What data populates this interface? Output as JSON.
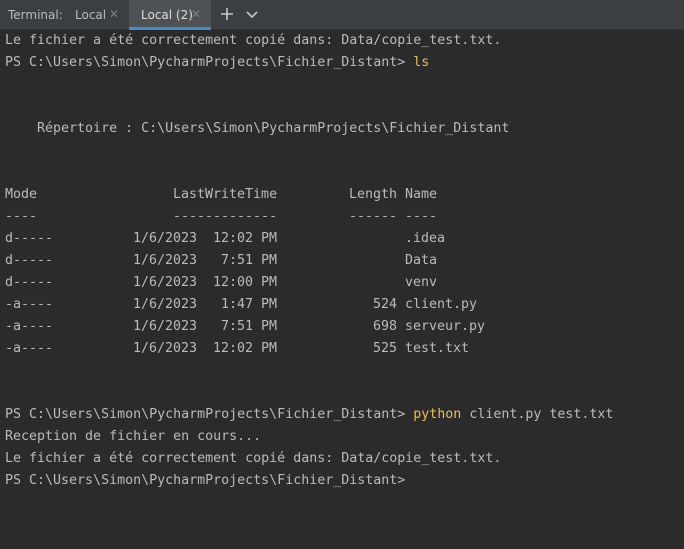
{
  "tabbar": {
    "label": "Terminal:",
    "tabs": [
      {
        "label": "Local"
      },
      {
        "label": "Local (2)"
      }
    ]
  },
  "icons": {
    "tab_close": "close-icon",
    "add": "plus-icon",
    "dropdown": "chevron-down-icon"
  },
  "colors": {
    "background": "#2b2b2b",
    "text": "#bbbbbb",
    "command": "#e9c14b",
    "tab_active_underline": "#4a88c7"
  },
  "terminal": {
    "line1": "Le fichier a été correctement copié dans: Data/copie_test.txt.",
    "prompt1": "PS C:\\Users\\Simon\\PycharmProjects\\Fichier_Distant> ",
    "cmd1": "ls",
    "dir_header": "    Répertoire : C:\\Users\\Simon\\PycharmProjects\\Fichier_Distant",
    "columns": {
      "mode": "Mode",
      "lastwritetime": "LastWriteTime",
      "length": "Length",
      "name": "Name"
    },
    "separators": {
      "mode": "----",
      "lastwritetime": "-------------",
      "length": "------",
      "name": "----"
    },
    "rows": [
      {
        "mode": "d-----",
        "date": "1/6/2023",
        "time": "12:02 PM",
        "length": "",
        "name": ".idea"
      },
      {
        "mode": "d-----",
        "date": "1/6/2023",
        "time": "7:51 PM",
        "length": "",
        "name": "Data"
      },
      {
        "mode": "d-----",
        "date": "1/6/2023",
        "time": "12:00 PM",
        "length": "",
        "name": "venv"
      },
      {
        "mode": "-a----",
        "date": "1/6/2023",
        "time": "1:47 PM",
        "length": "524",
        "name": "client.py"
      },
      {
        "mode": "-a----",
        "date": "1/6/2023",
        "time": "7:51 PM",
        "length": "698",
        "name": "serveur.py"
      },
      {
        "mode": "-a----",
        "date": "1/6/2023",
        "time": "12:02 PM",
        "length": "525",
        "name": "test.txt"
      }
    ],
    "prompt2": "PS C:\\Users\\Simon\\PycharmProjects\\Fichier_Distant> ",
    "cmd2": "python",
    "cmd2_args": " client.py test.txt",
    "line_reception": "Reception de fichier en cours...",
    "line_copied": "Le fichier a été correctement copié dans: Data/copie_test.txt.",
    "prompt3": "PS C:\\Users\\Simon\\PycharmProjects\\Fichier_Distant>"
  }
}
